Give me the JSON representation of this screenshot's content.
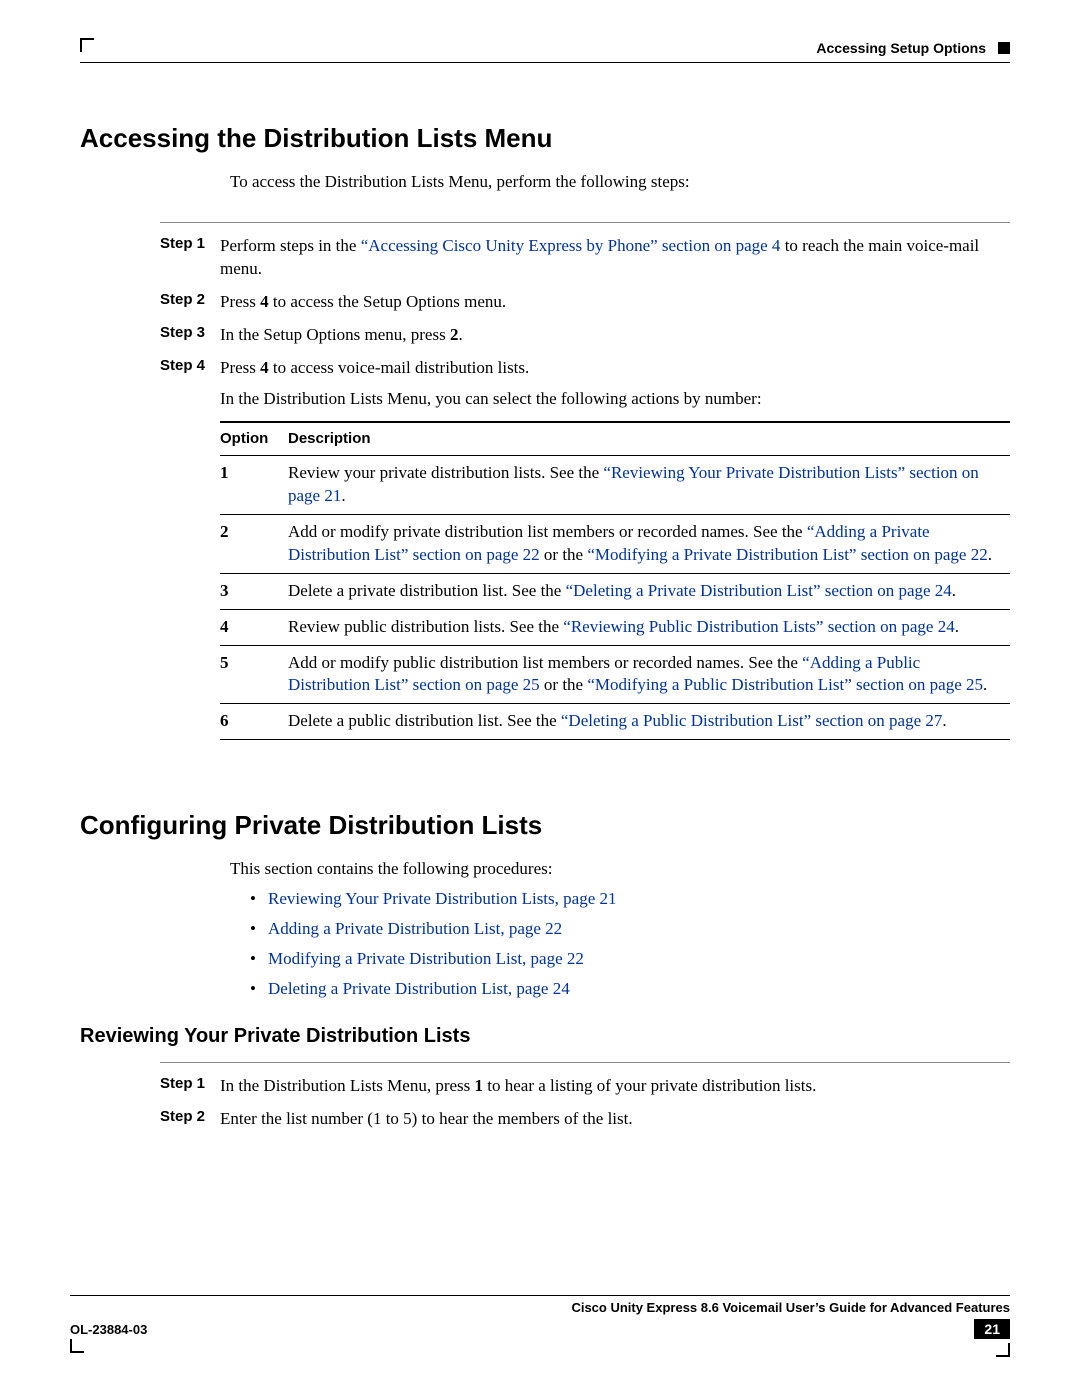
{
  "header": {
    "chapter": "Accessing Setup Options"
  },
  "section1": {
    "title": "Accessing the Distribution Lists Menu",
    "intro": "To access the Distribution Lists Menu, perform the following steps:",
    "steps": [
      {
        "label": "Step 1",
        "pre": "Perform steps in the ",
        "link": "“Accessing Cisco Unity Express by Phone” section on page 4",
        "post": " to reach the main voice-mail menu."
      },
      {
        "label": "Step 2",
        "pre": "Press ",
        "bold": "4",
        "post": " to access the Setup Options menu."
      },
      {
        "label": "Step 3",
        "pre": "In the Setup Options menu, press ",
        "bold": "2",
        "post": "."
      },
      {
        "label": "Step 4",
        "pre": "Press ",
        "bold": "4",
        "post": " to access voice-mail distribution lists."
      }
    ],
    "followup": "In the Distribution Lists Menu, you can select the following actions by number:",
    "table": {
      "headers": {
        "option": "Option",
        "description": "Description"
      },
      "rows": [
        {
          "option": "1",
          "desc": "Review your private distribution lists. See the “Reviewing Your Private Distribution Lists” section on page 21."
        },
        {
          "option": "2",
          "desc": "Add or modify private distribution list members or recorded names. See the “Adding a Private Distribution List” section on page 22 or the “Modifying a Private Distribution List” section on page 22."
        },
        {
          "option": "3",
          "desc": "Delete a private distribution list. See the “Deleting a Private Distribution List” section on page 24."
        },
        {
          "option": "4",
          "desc": "Review public distribution lists. See the “Reviewing Public Distribution Lists” section on page 24."
        },
        {
          "option": "5",
          "desc": "Add or modify public distribution list members or recorded names. See the “Adding a Public Distribution List” section on page 25 or the “Modifying a Public Distribution List” section on page 25."
        },
        {
          "option": "6",
          "desc": "Delete a public distribution list. See the “Deleting a Public Distribution List” section on page 27."
        }
      ]
    }
  },
  "section2": {
    "title": "Configuring Private Distribution Lists",
    "intro": "This section contains the following procedures:",
    "bullets": [
      "Reviewing Your Private Distribution Lists, page 21",
      "Adding a Private Distribution List, page 22",
      "Modifying a Private Distribution List, page 22",
      "Deleting a Private Distribution List, page 24"
    ],
    "subsection": {
      "title": "Reviewing Your Private Distribution Lists",
      "steps": [
        {
          "label": "Step 1",
          "pre": "In the Distribution Lists Menu, press ",
          "bold": "1",
          "post": " to hear a listing of your private distribution lists."
        },
        {
          "label": "Step 2",
          "pre": "Enter the list number (1 to 5) to hear the members of the list."
        }
      ]
    }
  },
  "footer": {
    "doc_title": "Cisco Unity Express 8.6 Voicemail User’s Guide for Advanced Features",
    "doc_id": "OL-23884-03",
    "page": "21"
  }
}
